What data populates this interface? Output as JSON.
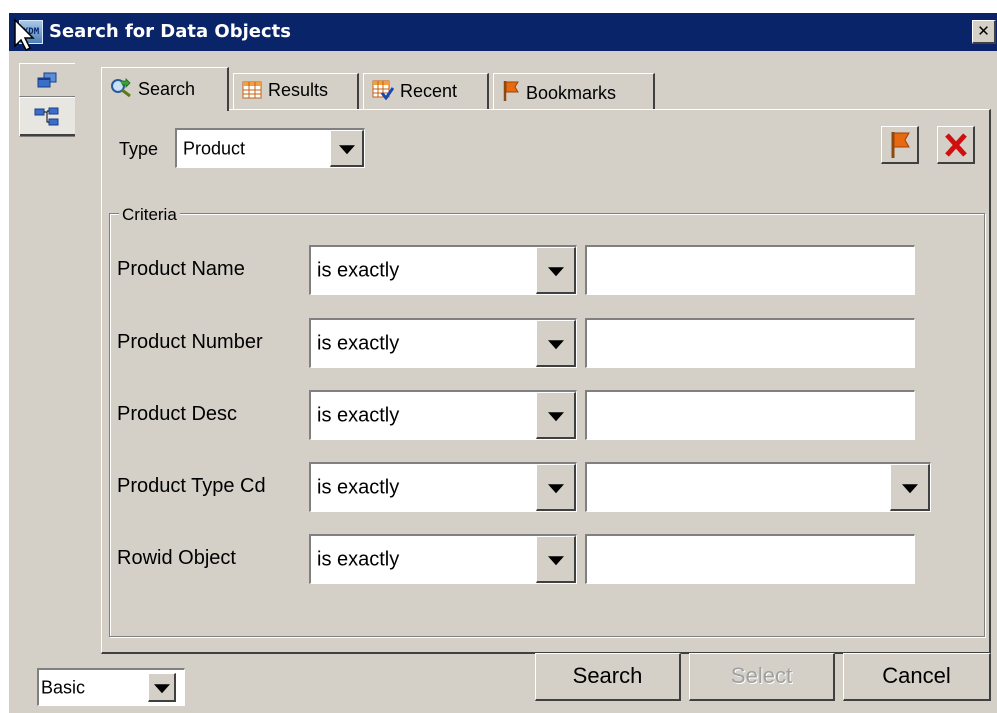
{
  "window": {
    "title": "Search for Data Objects",
    "icon_text": "XDM",
    "close_label": "✕"
  },
  "side_tabs": [
    {
      "name": "windows-icon"
    },
    {
      "name": "hierarchy-icon"
    }
  ],
  "tabs": [
    {
      "label": "Search",
      "icon": "search-icon",
      "active": true
    },
    {
      "label": "Results",
      "icon": "grid-icon",
      "active": false
    },
    {
      "label": "Recent",
      "icon": "recent-icon",
      "active": false
    },
    {
      "label": "Bookmarks",
      "icon": "bookmark-flag-icon",
      "active": false
    }
  ],
  "type_selector": {
    "label": "Type",
    "value": "Product"
  },
  "criteria": {
    "legend": "Criteria",
    "rows": [
      {
        "label": "Product Name",
        "operator": "is exactly",
        "value": "",
        "value_is_dropdown": false
      },
      {
        "label": "Product Number",
        "operator": "is exactly",
        "value": "",
        "value_is_dropdown": false
      },
      {
        "label": "Product Desc",
        "operator": "is exactly",
        "value": "",
        "value_is_dropdown": false
      },
      {
        "label": "Product Type Cd",
        "operator": "is exactly",
        "value": "",
        "value_is_dropdown": true
      },
      {
        "label": "Rowid Object",
        "operator": "is exactly",
        "value": "",
        "value_is_dropdown": false
      }
    ]
  },
  "footer": {
    "mode": "Basic",
    "search_label": "Search",
    "select_label": "Select",
    "cancel_label": "Cancel"
  },
  "colors": {
    "title_bar": "#0a246a",
    "face": "#d4d0c8",
    "bookmark_flag": "#e86a10",
    "clear_x": "#d01010"
  }
}
